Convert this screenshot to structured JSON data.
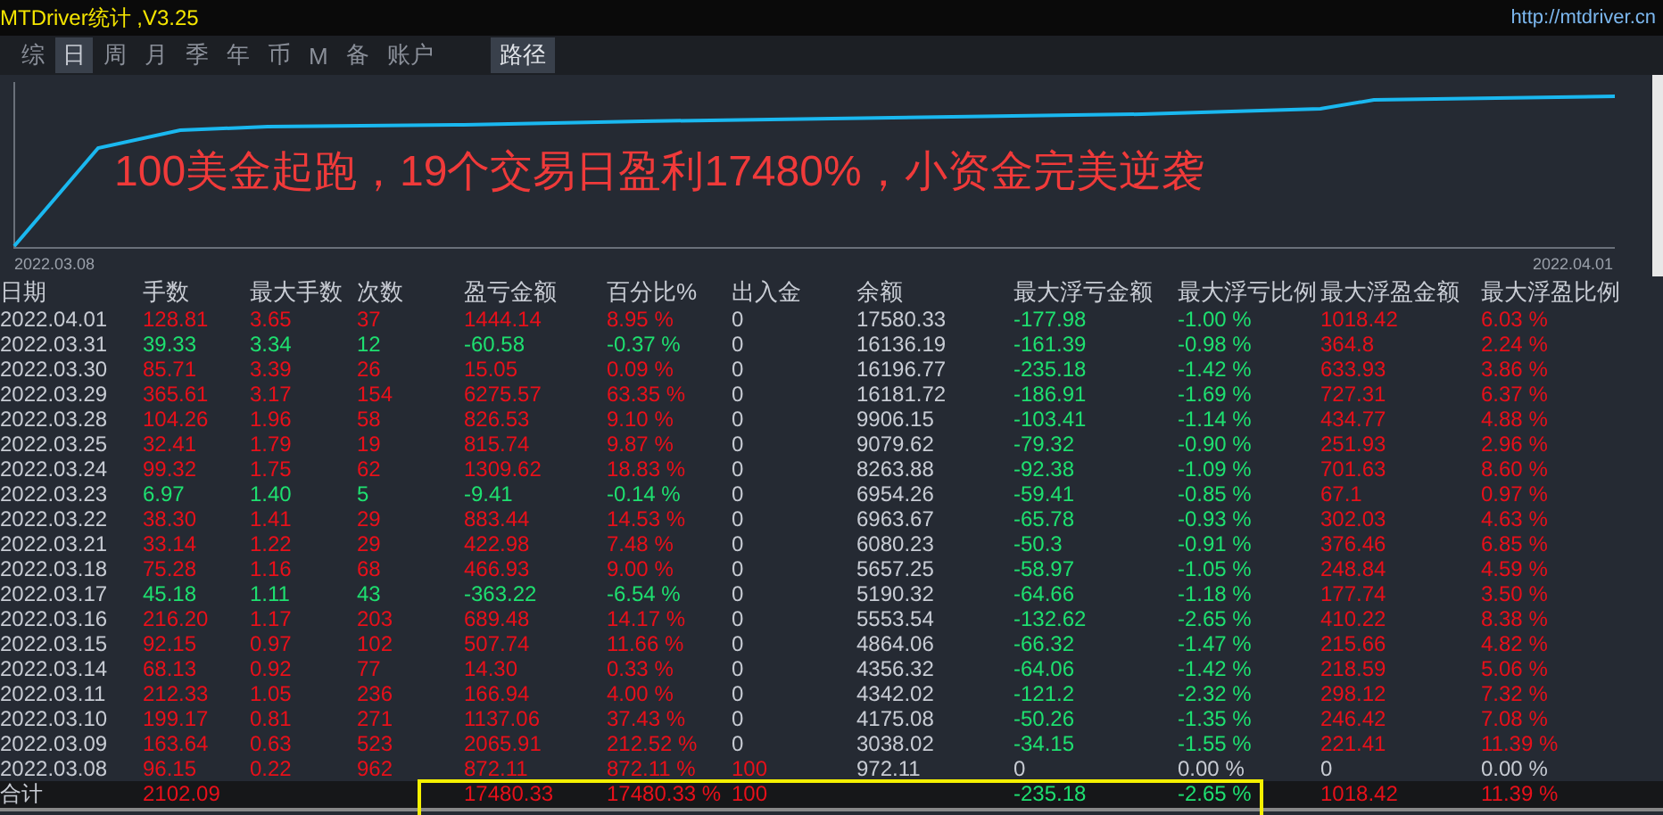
{
  "window": {
    "title": "MTDriver统计 ,V3.25",
    "link": "http://mtdriver.cn"
  },
  "tabs": [
    {
      "label": "综",
      "selected": false
    },
    {
      "label": "日",
      "selected": true
    },
    {
      "label": "周",
      "selected": false
    },
    {
      "label": "月",
      "selected": false
    },
    {
      "label": "季",
      "selected": false
    },
    {
      "label": "年",
      "selected": false
    },
    {
      "label": "币",
      "selected": false
    },
    {
      "label": "M",
      "selected": false
    },
    {
      "label": "备",
      "selected": false
    },
    {
      "label": "账户",
      "selected": false
    }
  ],
  "path_button": "路径",
  "chart": {
    "headline": "100美金起跑，19个交易日盈利17480%，小资金完美逆袭",
    "start_date": "2022.03.08",
    "end_date": "2022.04.01"
  },
  "table": {
    "columns": [
      "日期",
      "手数",
      "最大手数",
      "次数",
      "盈亏金额",
      "百分比%",
      "出入金",
      "余额",
      "最大浮亏金额",
      "最大浮亏比例",
      "最大浮盈金额",
      "最大浮盈比例"
    ],
    "rows": [
      {
        "kind": "profit",
        "cells": [
          "2022.04.01",
          "128.81",
          "3.65",
          "37",
          "1444.14",
          "8.95 %",
          "0",
          "17580.33",
          "-177.98",
          "-1.00 %",
          "1018.42",
          "6.03 %"
        ]
      },
      {
        "kind": "loss",
        "cells": [
          "2022.03.31",
          "39.33",
          "3.34",
          "12",
          "-60.58",
          "-0.37 %",
          "0",
          "16136.19",
          "-161.39",
          "-0.98 %",
          "364.8",
          "2.24 %"
        ]
      },
      {
        "kind": "profit",
        "cells": [
          "2022.03.30",
          "85.71",
          "3.39",
          "26",
          "15.05",
          "0.09 %",
          "0",
          "16196.77",
          "-235.18",
          "-1.42 %",
          "633.93",
          "3.86 %"
        ]
      },
      {
        "kind": "profit",
        "cells": [
          "2022.03.29",
          "365.61",
          "3.17",
          "154",
          "6275.57",
          "63.35 %",
          "0",
          "16181.72",
          "-186.91",
          "-1.69 %",
          "727.31",
          "6.37 %"
        ]
      },
      {
        "kind": "profit",
        "cells": [
          "2022.03.28",
          "104.26",
          "1.96",
          "58",
          "826.53",
          "9.10 %",
          "0",
          "9906.15",
          "-103.41",
          "-1.14 %",
          "434.77",
          "4.88 %"
        ]
      },
      {
        "kind": "profit",
        "cells": [
          "2022.03.25",
          "32.41",
          "1.79",
          "19",
          "815.74",
          "9.87 %",
          "0",
          "9079.62",
          "-79.32",
          "-0.90 %",
          "251.93",
          "2.96 %"
        ]
      },
      {
        "kind": "profit",
        "cells": [
          "2022.03.24",
          "99.32",
          "1.75",
          "62",
          "1309.62",
          "18.83 %",
          "0",
          "8263.88",
          "-92.38",
          "-1.09 %",
          "701.63",
          "8.60 %"
        ]
      },
      {
        "kind": "loss",
        "cells": [
          "2022.03.23",
          "6.97",
          "1.40",
          "5",
          "-9.41",
          "-0.14 %",
          "0",
          "6954.26",
          "-59.41",
          "-0.85 %",
          "67.1",
          "0.97 %"
        ]
      },
      {
        "kind": "profit",
        "cells": [
          "2022.03.22",
          "38.30",
          "1.41",
          "29",
          "883.44",
          "14.53 %",
          "0",
          "6963.67",
          "-65.78",
          "-0.93 %",
          "302.03",
          "4.63 %"
        ]
      },
      {
        "kind": "profit",
        "cells": [
          "2022.03.21",
          "33.14",
          "1.22",
          "29",
          "422.98",
          "7.48 %",
          "0",
          "6080.23",
          "-50.3",
          "-0.91 %",
          "376.46",
          "6.85 %"
        ]
      },
      {
        "kind": "profit",
        "cells": [
          "2022.03.18",
          "75.28",
          "1.16",
          "68",
          "466.93",
          "9.00 %",
          "0",
          "5657.25",
          "-58.97",
          "-1.05 %",
          "248.84",
          "4.59 %"
        ]
      },
      {
        "kind": "loss",
        "cells": [
          "2022.03.17",
          "45.18",
          "1.11",
          "43",
          "-363.22",
          "-6.54 %",
          "0",
          "5190.32",
          "-64.66",
          "-1.18 %",
          "177.74",
          "3.50 %"
        ]
      },
      {
        "kind": "profit",
        "cells": [
          "2022.03.16",
          "216.20",
          "1.17",
          "203",
          "689.48",
          "14.17 %",
          "0",
          "5553.54",
          "-132.62",
          "-2.65 %",
          "410.22",
          "8.38 %"
        ]
      },
      {
        "kind": "profit",
        "cells": [
          "2022.03.15",
          "92.15",
          "0.97",
          "102",
          "507.74",
          "11.66 %",
          "0",
          "4864.06",
          "-66.32",
          "-1.47 %",
          "215.66",
          "4.82 %"
        ]
      },
      {
        "kind": "profit",
        "cells": [
          "2022.03.14",
          "68.13",
          "0.92",
          "77",
          "14.30",
          "0.33 %",
          "0",
          "4356.32",
          "-64.06",
          "-1.42 %",
          "218.59",
          "5.06 %"
        ]
      },
      {
        "kind": "profit",
        "cells": [
          "2022.03.11",
          "212.33",
          "1.05",
          "236",
          "166.94",
          "4.00 %",
          "0",
          "4342.02",
          "-121.2",
          "-2.32 %",
          "298.12",
          "7.32 %"
        ]
      },
      {
        "kind": "profit",
        "cells": [
          "2022.03.10",
          "199.17",
          "0.81",
          "271",
          "1137.06",
          "37.43 %",
          "0",
          "4175.08",
          "-50.26",
          "-1.35 %",
          "246.42",
          "7.08 %"
        ]
      },
      {
        "kind": "profit",
        "cells": [
          "2022.03.09",
          "163.64",
          "0.63",
          "523",
          "2065.91",
          "212.52 %",
          "0",
          "3038.02",
          "-34.15",
          "-1.55 %",
          "221.41",
          "11.39 %"
        ]
      },
      {
        "kind": "start",
        "cells": [
          "2022.03.08",
          "96.15",
          "0.22",
          "962",
          "872.11",
          "872.11 %",
          "100",
          "972.11",
          "0",
          "0.00 %",
          "0",
          "0.00 %"
        ]
      }
    ],
    "total": {
      "cells": [
        "合计",
        "2102.09",
        "",
        "",
        "17480.33",
        "17480.33 %",
        "100",
        "",
        "-235.18",
        "-2.65 %",
        "1018.42",
        "11.39 %"
      ]
    }
  }
}
